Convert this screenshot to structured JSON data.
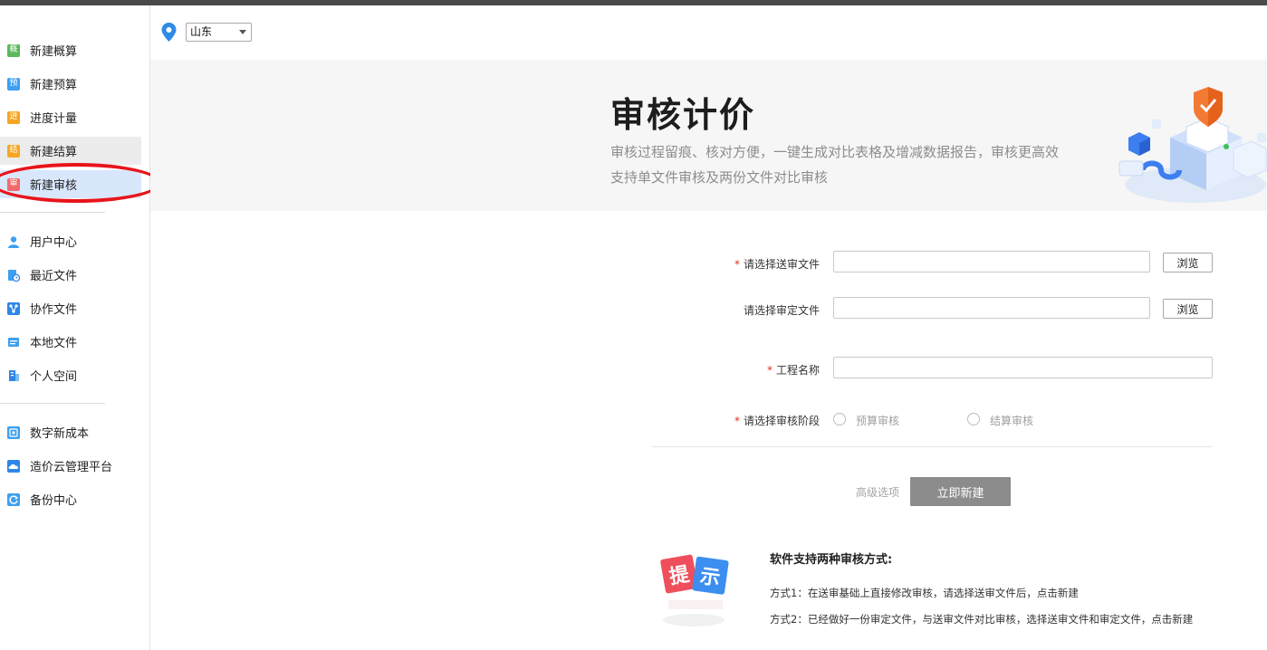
{
  "sidebar": {
    "group1": [
      {
        "label": "新建概算",
        "icon": "gai-badge-icon",
        "icon_text": "概",
        "icon_color": "#5cb85c"
      },
      {
        "label": "新建预算",
        "icon": "yu-badge-icon",
        "icon_text": "预",
        "icon_color": "#3ea0f0"
      },
      {
        "label": "进度计量",
        "icon": "jin-badge-icon",
        "icon_text": "进",
        "icon_color": "#f5a623"
      },
      {
        "label": "新建结算",
        "icon": "jie-badge-icon",
        "icon_text": "结",
        "icon_color": "#f5a623"
      },
      {
        "label": "新建审核",
        "icon": "shen-badge-icon",
        "icon_text": "审",
        "icon_color": "#f06a6a"
      }
    ],
    "group2": [
      {
        "label": "用户中心",
        "icon": "user-icon",
        "icon_color": "#3ea0f0"
      },
      {
        "label": "最近文件",
        "icon": "recent-file-icon",
        "icon_color": "#3ea0f0"
      },
      {
        "label": "协作文件",
        "icon": "collab-file-icon",
        "icon_color": "#2f86e8"
      },
      {
        "label": "本地文件",
        "icon": "local-file-icon",
        "icon_color": "#3ea0f0"
      },
      {
        "label": "个人空间",
        "icon": "personal-space-icon",
        "icon_color": "#2f86e8"
      }
    ],
    "group3": [
      {
        "label": "数字新成本",
        "icon": "digital-cost-icon",
        "icon_color": "#3ea0f0"
      },
      {
        "label": "造价云管理平台",
        "icon": "cloud-platform-icon",
        "icon_color": "#2f86e8"
      },
      {
        "label": "备份中心",
        "icon": "backup-icon",
        "icon_color": "#3ea0f0"
      }
    ],
    "active": "新建审核",
    "hover": "新建结算"
  },
  "region": {
    "value": "山东"
  },
  "banner": {
    "title": "审核计价",
    "subtitle_line1": "审核过程留痕、核对方便，一键生成对比表格及增减数据报告，审核更高效",
    "subtitle_line2": "支持单文件审核及两份文件对比审核"
  },
  "form": {
    "submit_file_label": "请选择送审文件",
    "approved_file_label": "请选择审定文件",
    "project_name_label": "工程名称",
    "stage_label": "请选择审核阶段",
    "required_mark": "*",
    "browse_label": "浏览",
    "stage_options": [
      "预算审核",
      "结算审核"
    ],
    "advanced_label": "高级选项",
    "create_label": "立即新建"
  },
  "tip": {
    "icon_text_1": "提",
    "icon_text_2": "示",
    "title": "软件支持两种审核方式:",
    "line1": "方式1：在送审基础上直接修改审核，请选择送审文件后，点击新建",
    "line2": "方式2：已经做好一份审定文件，与送审文件对比审核，选择送审文件和审定文件，点击新建"
  }
}
